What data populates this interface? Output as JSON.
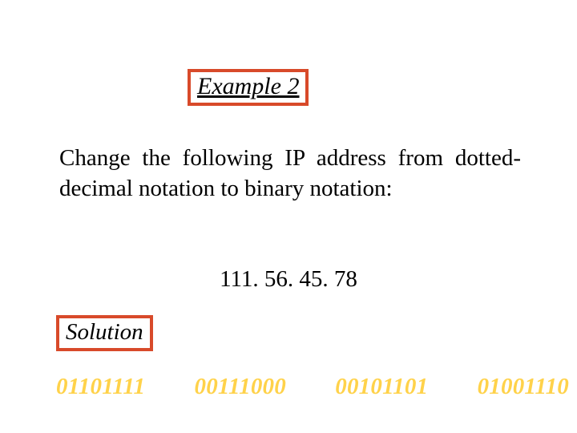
{
  "title": "Example 2",
  "prompt": "Change the following IP address from dotted-decimal notation to binary notation:",
  "ip_address": "111. 56. 45. 78",
  "solution_label": "Solution",
  "binary": {
    "octet1": "01101111",
    "octet2": "00111000",
    "octet3": "00101101",
    "octet4": "01001110"
  },
  "colors": {
    "box_border": "#d84a2a",
    "binary_text": "#ffd24a"
  }
}
